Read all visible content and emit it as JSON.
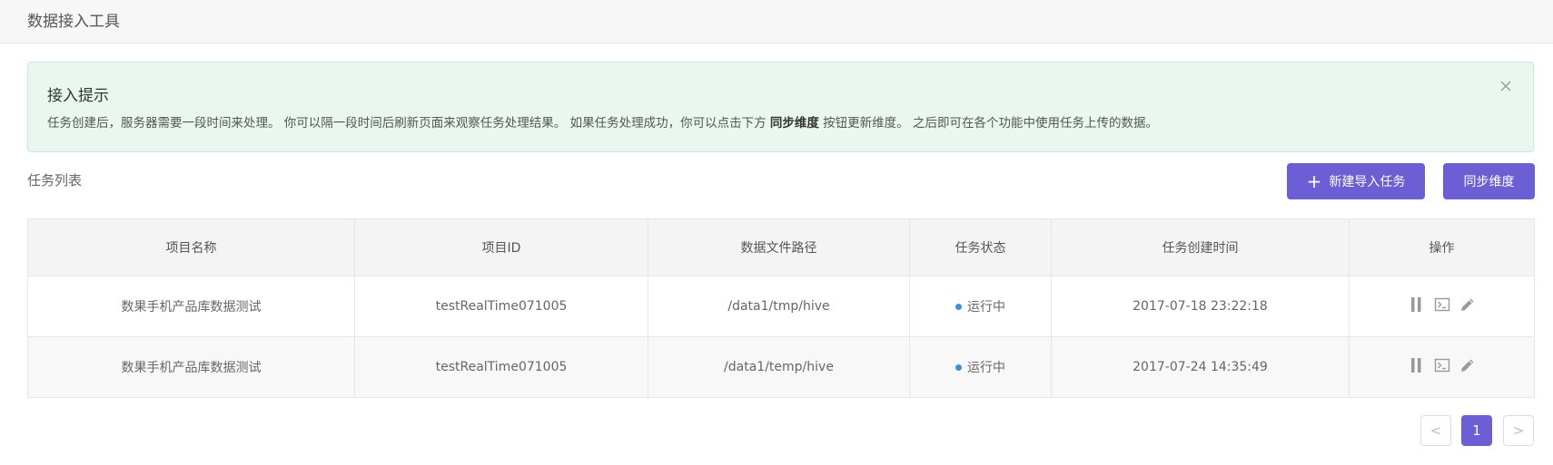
{
  "header": {
    "title": "数据接入工具"
  },
  "alert": {
    "title": "接入提示",
    "desc_before": "任务创建后，服务器需要一段时间来处理。 你可以隔一段时间后刷新页面来观察任务处理结果。 如果任务处理成功，你可以点击下方 ",
    "desc_bold": "同步维度",
    "desc_after": " 按钮更新维度。 之后即可在各个功能中使用任务上传的数据。",
    "close_icon": "close-icon"
  },
  "section": {
    "title": "任务列表"
  },
  "toolbar": {
    "new_task_icon": "+",
    "new_task_label": "新建导入任务",
    "sync_label": "同步维度"
  },
  "table": {
    "columns": [
      "项目名称",
      "项目ID",
      "数据文件路径",
      "任务状态",
      "任务创建时间",
      "操作"
    ],
    "rows": [
      {
        "name": "数果手机产品库数据测试",
        "project_id": "testRealTime071005",
        "path": "/data1/tmp/hive",
        "status": "运行中",
        "created": "2017-07-18 23:22:18"
      },
      {
        "name": "数果手机产品库数据测试",
        "project_id": "testRealTime071005",
        "path": "/data1/temp/hive",
        "status": "运行中",
        "created": "2017-07-24 14:35:49"
      }
    ],
    "status_color": "#3a8ee6",
    "op_icons": [
      "pause-icon",
      "terminal-icon",
      "edit-icon"
    ]
  },
  "pagination": {
    "prev": "<",
    "page": "1",
    "next": ">"
  },
  "colors": {
    "accent": "#6c5fd6",
    "alert_bg": "#eaf7f0"
  }
}
